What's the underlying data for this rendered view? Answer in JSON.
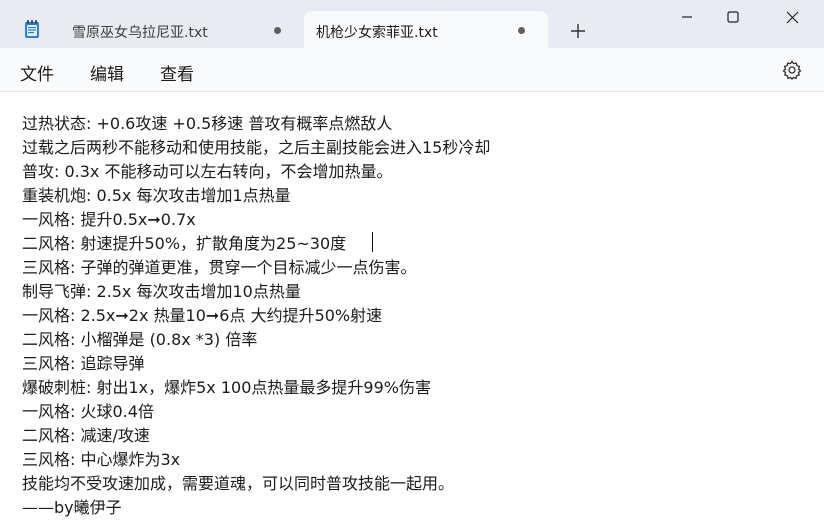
{
  "tabs": [
    {
      "label": "雪原巫女乌拉尼亚.txt",
      "icon": "notepad-icon",
      "active": false
    },
    {
      "label": "机枪少女索菲亚.txt",
      "active": true
    }
  ],
  "window_controls": [
    "minimize-icon",
    "maximize-icon",
    "close-icon"
  ],
  "menu": {
    "file": "文件",
    "edit": "编辑",
    "view": "查看",
    "settings_icon": "gear-icon"
  },
  "editor": {
    "lines": [
      "过热状态: +0.6攻速 +0.5移速 普攻有概率点燃敌人",
      "过载之后两秒不能移动和使用技能，之后主副技能会进入15秒冷却",
      "普攻: 0.3x 不能移动可以左右转向，不会增加热量。",
      "重装机炮: 0.5x 每次攻击增加1点热量",
      "一风格: 提升0.5x➞0.7x",
      "二风格: 射速提升50%，扩散角度为25~30度",
      "三风格: 子弹的弹道更准，贯穿一个目标减少一点伤害。",
      "制导飞弹: 2.5x 每次攻击增加10点热量",
      "一风格: 2.5x➞2x 热量10➞6点 大约提升50%射速",
      "二风格: 小榴弹是 (0.8x *3) 倍率",
      "三风格: 追踪导弹",
      "爆破刺桩: 射出1x，爆炸5x 100点热量最多提升99%伤害",
      "一风格: 火球0.4倍",
      "二风格: 减速/攻速",
      "三风格: 中心爆炸为3x",
      "技能均不受攻速加成，需要道魂，可以同时普攻技能一起用。",
      "——by曦伊子"
    ]
  },
  "colors": {
    "titlebar": "#e8ecf2",
    "active_tab": "#f9fafb",
    "menubar": "#f9fafb",
    "editor_bg": "#ffffff",
    "text": "#1b1b1b"
  }
}
